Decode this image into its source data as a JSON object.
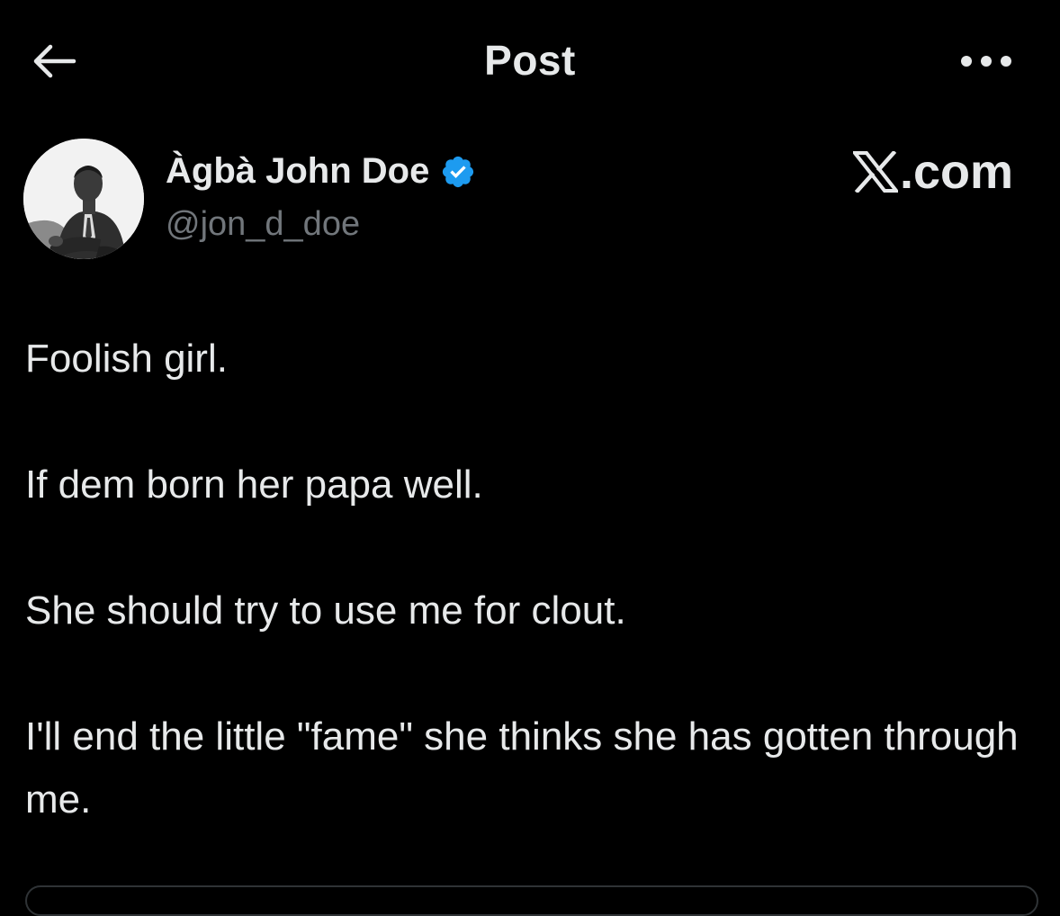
{
  "header": {
    "title": "Post",
    "back_icon": "arrow-left-icon",
    "more_icon": "more-horizontal-icon"
  },
  "author": {
    "display_name": "Àgbà John Doe",
    "handle": "@jon_d_doe",
    "verified": true,
    "verified_color": "#1d9bf0",
    "avatar_icon": "profile-photo"
  },
  "watermark": {
    "text": ".com",
    "logo_icon": "x-logo-icon"
  },
  "post": {
    "paragraphs": [
      "Foolish girl.",
      "If dem born her papa well.",
      "She should try to use me for clout.",
      "I'll end the little \"fame\" she thinks she has gotten through me."
    ]
  },
  "colors": {
    "background": "#000000",
    "text_primary": "#e7e9ea",
    "text_secondary": "#71767b",
    "accent": "#1d9bf0",
    "border": "#2f3336"
  }
}
